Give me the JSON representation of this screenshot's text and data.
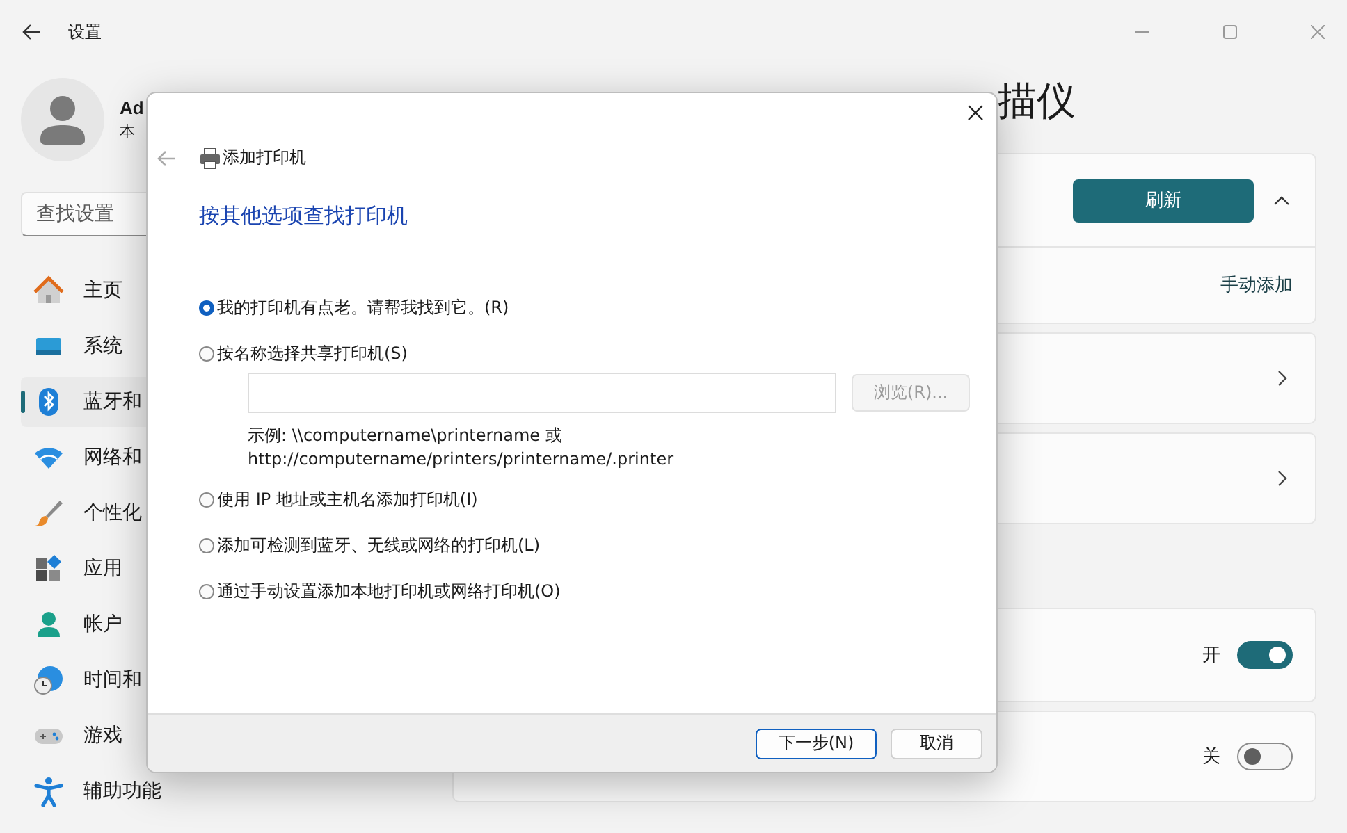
{
  "window": {
    "title": "设置"
  },
  "profile": {
    "name": "Ad",
    "subtitle": "本"
  },
  "search": {
    "placeholder": "查找设置"
  },
  "sidebar": {
    "items": [
      {
        "label": "主页",
        "selected": false
      },
      {
        "label": "系统",
        "selected": false
      },
      {
        "label": "蓝牙和",
        "selected": true
      },
      {
        "label": "网络和",
        "selected": false
      },
      {
        "label": "个性化",
        "selected": false
      },
      {
        "label": "应用",
        "selected": false
      },
      {
        "label": "帐户",
        "selected": false
      },
      {
        "label": "时间和",
        "selected": false
      },
      {
        "label": "游戏",
        "selected": false
      },
      {
        "label": "辅助功能",
        "selected": false
      }
    ]
  },
  "page": {
    "title": "描仪"
  },
  "cards": [
    {
      "kind": "header",
      "button": "刷新",
      "expanded": true
    },
    {
      "kind": "action",
      "link": "手动添加"
    },
    {
      "kind": "nav"
    },
    {
      "kind": "nav"
    },
    {
      "kind": "toggle",
      "state_label": "开",
      "on": true
    },
    {
      "kind": "toggle",
      "state_label": "关",
      "on": false
    }
  ],
  "dialog": {
    "title": "添加打印机",
    "heading": "按其他选项查找打印机",
    "options": [
      {
        "label": "我的打印机有点老。请帮我找到它。(R)",
        "selected": true
      },
      {
        "label": "按名称选择共享打印机(S)",
        "selected": false,
        "path_field": {
          "browse_button": {
            "label": "浏览(R)...",
            "disabled": true
          },
          "example": [
            "示例: \\\\computername\\printername 或",
            "http://computername/printers/printername/.printer"
          ]
        }
      },
      {
        "label": "使用 IP 地址或主机名添加打印机(I)",
        "selected": false
      },
      {
        "label": "添加可检测到蓝牙、无线或网络的打印机(L)",
        "selected": false
      },
      {
        "label": "通过手动设置添加本地打印机或网络打印机(O)",
        "selected": false
      }
    ],
    "buttons": [
      {
        "label": "下一步(N)",
        "default": true
      },
      {
        "label": "取消",
        "default": false
      }
    ]
  }
}
